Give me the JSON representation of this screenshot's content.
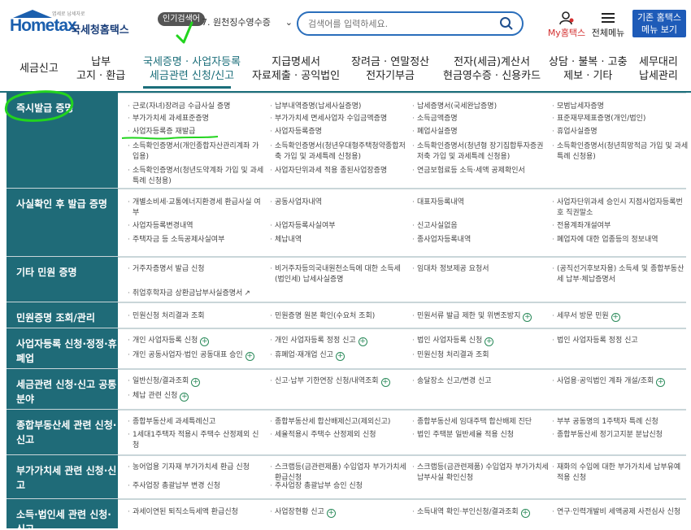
{
  "header": {
    "logo_small": "엽세로 납세자로",
    "logo_text": "Hometax",
    "logo_ko": "국세청홈택스",
    "popular_badge": "인기검색어",
    "popular_select": "7. 원천징수영수증",
    "search_placeholder": "검색어를 입력하세요.",
    "myhome_label": "My홈택스",
    "allmenu_label": "전체메뉴",
    "oldhome_line1": "기존 홈택스",
    "oldhome_line2": "메뉴 보기"
  },
  "nav": [
    {
      "line1": "세금신고",
      "line2": ""
    },
    {
      "line1": "납부",
      "line2": "고지 · 환급"
    },
    {
      "line1": "국세증명 · 사업자등록",
      "line2": "세금관련 신청/신고"
    },
    {
      "line1": "지급명세서",
      "line2": "자료제출 · 공익법인"
    },
    {
      "line1": "장려금 · 연말정산",
      "line2": "전자기부금"
    },
    {
      "line1": "전자(세금)계산서",
      "line2": "현금영수증 · 신용카드"
    },
    {
      "line1": "상담 · 불복 · 고충",
      "line2": "제보 · 기타"
    },
    {
      "line1": "세무대리",
      "line2": "납세관리"
    }
  ],
  "rows": [
    {
      "head": "즉시발급 증명",
      "items": [
        "근로(자녀)장려금 수급사실 증명",
        "납부내역증명(납세사실증명)",
        "납세증명서(국세완납증명)",
        "모범납세자증명",
        "부가가치세 과세표준증명",
        "부가가치세 면세사업자 수입금액증명",
        "소득금액증명",
        "표준재무제표증명(개인/법인)",
        "사업자등록증 재발급",
        "사업자등록증명",
        "폐업사실증명",
        "휴업사실증명",
        "소득확인증명서(개인종합자산관리계좌 가입용)",
        "소득확인증명서(청년우대형주택청약종합저축 가입 및 과세특례 신청용)",
        "소득확인증명서(청년형 장기집합투자증권저축 가입 및 과세특례 신청용)",
        "소득확인증명서(청년희망적금 가입 및 과세특례 신청용)",
        "소득확인증명서(청년도약계좌 가입 및 과세특례 신청용)",
        "사업자단위과세 적용 종된사업장증명",
        "연금보험료등 소득·세액 공제확인서",
        ""
      ]
    },
    {
      "head": "사실확인 후 발급 증명",
      "items": [
        "개별소비세·교통에너지환경세 환급사실 여부",
        "공동사업자내역",
        "대표자등록내역",
        "사업자단위과세 승인시 지점사업자등록번호 직권말소",
        "사업자등록변경내역",
        "사업자등록사실여부",
        "신고사실없음",
        "전용계좌개설여부",
        "주택자금 등 소득공제사실여부",
        "체납내역",
        "종사업자등록내역",
        "폐업자에 대한 업종등의 정보내역"
      ]
    },
    {
      "head": "기타 민원 증명",
      "items": [
        "거주자증명서 발급 신청",
        "비거주자등의국내원천소득에 대한 소득세(법인세) 납세사실증명",
        "임대차 정보제공 요청서",
        "(공직선거후보자용) 소득세 및 종합부동산세 납부·체납증명서",
        "취업후학자금 상환금납부사실증명서"
      ]
    },
    {
      "head": "민원증명 조회/관리",
      "items": [
        "민원신청 처리결과 조회",
        "민원증명 원본 확인(수요처 조회)",
        "민원서류 발급 제한 및 위변조방지",
        "세무서 방문 민원"
      ]
    },
    {
      "head": "사업자등록 신청·정정·휴폐업",
      "items": [
        "개인 사업자등록 신청",
        "개인 사업자등록 정정 신고",
        "법인 사업자등록 신청",
        "법인 사업자등록 정정 신고",
        "개인 공동사업자·법인 공동대표 승인",
        "휴폐업·재개업 신고",
        "민원신청 처리결과 조회",
        ""
      ]
    },
    {
      "head": "세금관련 신청·신고 공통분야",
      "items": [
        "일반신청/결과조회",
        "신고·납부 기한연장 신청/내역조회",
        "송달장소 신고/변경 신고",
        "사업용·공익법인 계좌 개설/조회",
        "체납 관련 신청",
        "",
        "",
        ""
      ]
    },
    {
      "head": "종합부동산세 관련 신청·신고",
      "items": [
        "종합부동산세 과세특례신고",
        "종합부동산세 합산배제신고(제외신고)",
        "종합부동산세 임대주택 합산배제 진단",
        "부부 공동명의 1주택자 특례 신청",
        "1세대1주택자 적용시 주택수 산정제외 신청",
        "세율적용시 주택수 산정제외 신청",
        "법인 주택분 일반세율 적용 신청",
        "종합부동산세 정기고지분 분납신청"
      ]
    },
    {
      "head": "부가가치세 관련 신청·신고",
      "items": [
        "농어업용 기자재 부가가치세 환급 신청",
        "스크랩등(금관련제품) 수입업자 부가가치세 환급신청",
        "스크랩등(금관련제품) 수입업자 부가가치세 납부사실 확인신청",
        "재화의 수입에 대한 부가가치세 납부유예 적용 신청",
        "주사업장 총괄납부 변경 신청",
        "주사업장 총괄납부 승인 신청",
        "",
        ""
      ]
    },
    {
      "head": "소득·법인세 관련 신청·신고",
      "items": [
        "과세이연된 퇴직소득세액 환급신청",
        "사업장현황 신고",
        "소득내역 확인·부인신청/결과조회",
        "연구·인력개발비 세액공제 사전심사 신청"
      ]
    }
  ]
}
